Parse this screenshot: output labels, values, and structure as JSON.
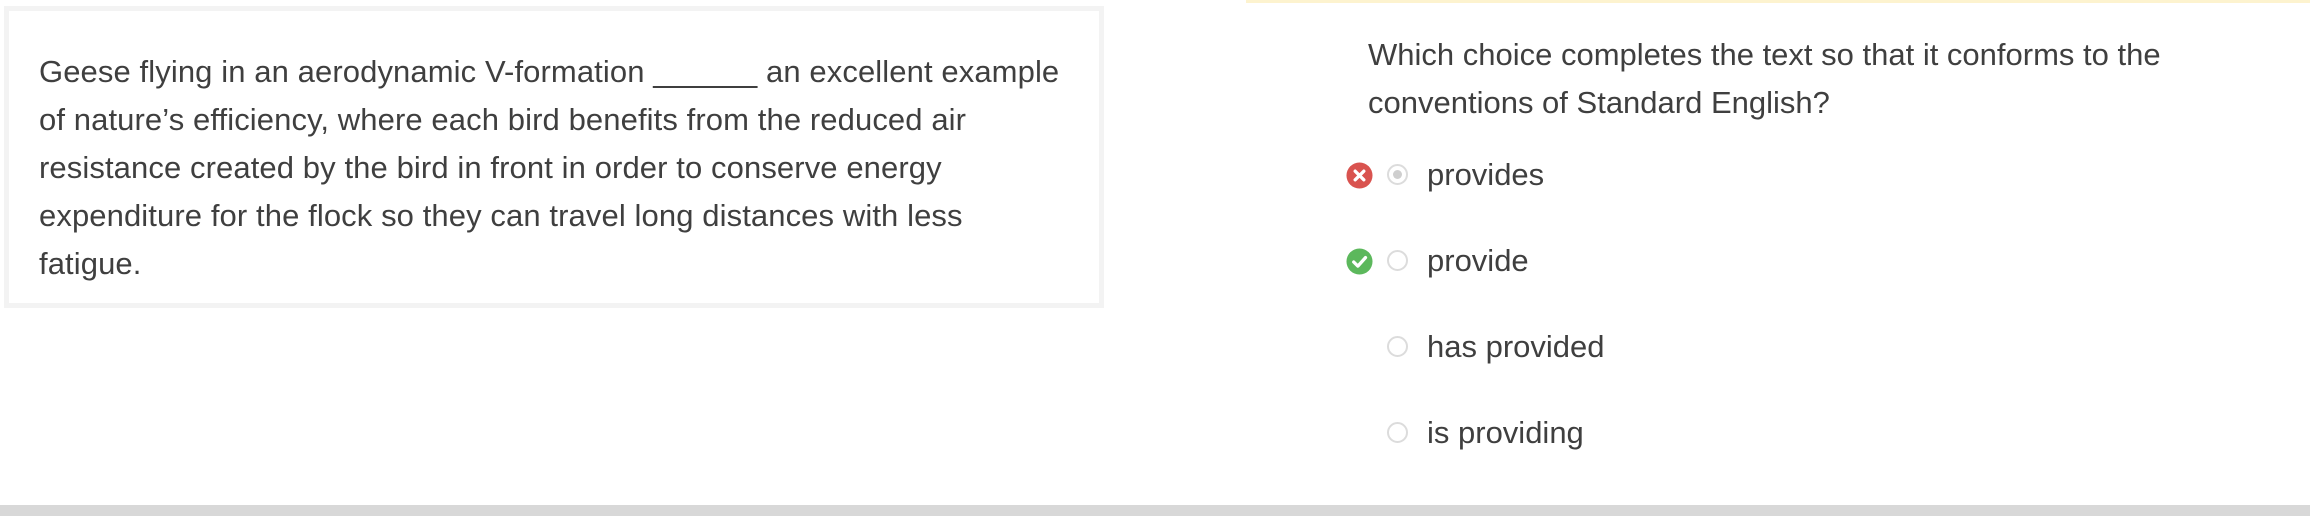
{
  "passage": {
    "text": "Geese flying in an aerodynamic V-formation ______ an excellent example of nature’s efficiency, where each bird benefits from the reduced air resistance created by the bird in front in order to conserve energy expenditure for the flock so they can travel long distances with less fatigue."
  },
  "question": {
    "prompt": "Which choice completes the text so that it conforms to the conventions of Standard English?",
    "choices": [
      {
        "label": "provides",
        "selected": true,
        "status": "incorrect",
        "status_icon": "x-circle-icon",
        "status_color": "#d9534f"
      },
      {
        "label": "provide",
        "selected": false,
        "status": "correct",
        "status_icon": "check-circle-icon",
        "status_color": "#5cb85c"
      },
      {
        "label": "has provided",
        "selected": false,
        "status": "none"
      },
      {
        "label": "is providing",
        "selected": false,
        "status": "none"
      }
    ]
  },
  "colors": {
    "text": "#3f3f3f",
    "incorrect": "#d9534f",
    "correct": "#5cb85c",
    "accent_line": "#fdf3cf"
  }
}
